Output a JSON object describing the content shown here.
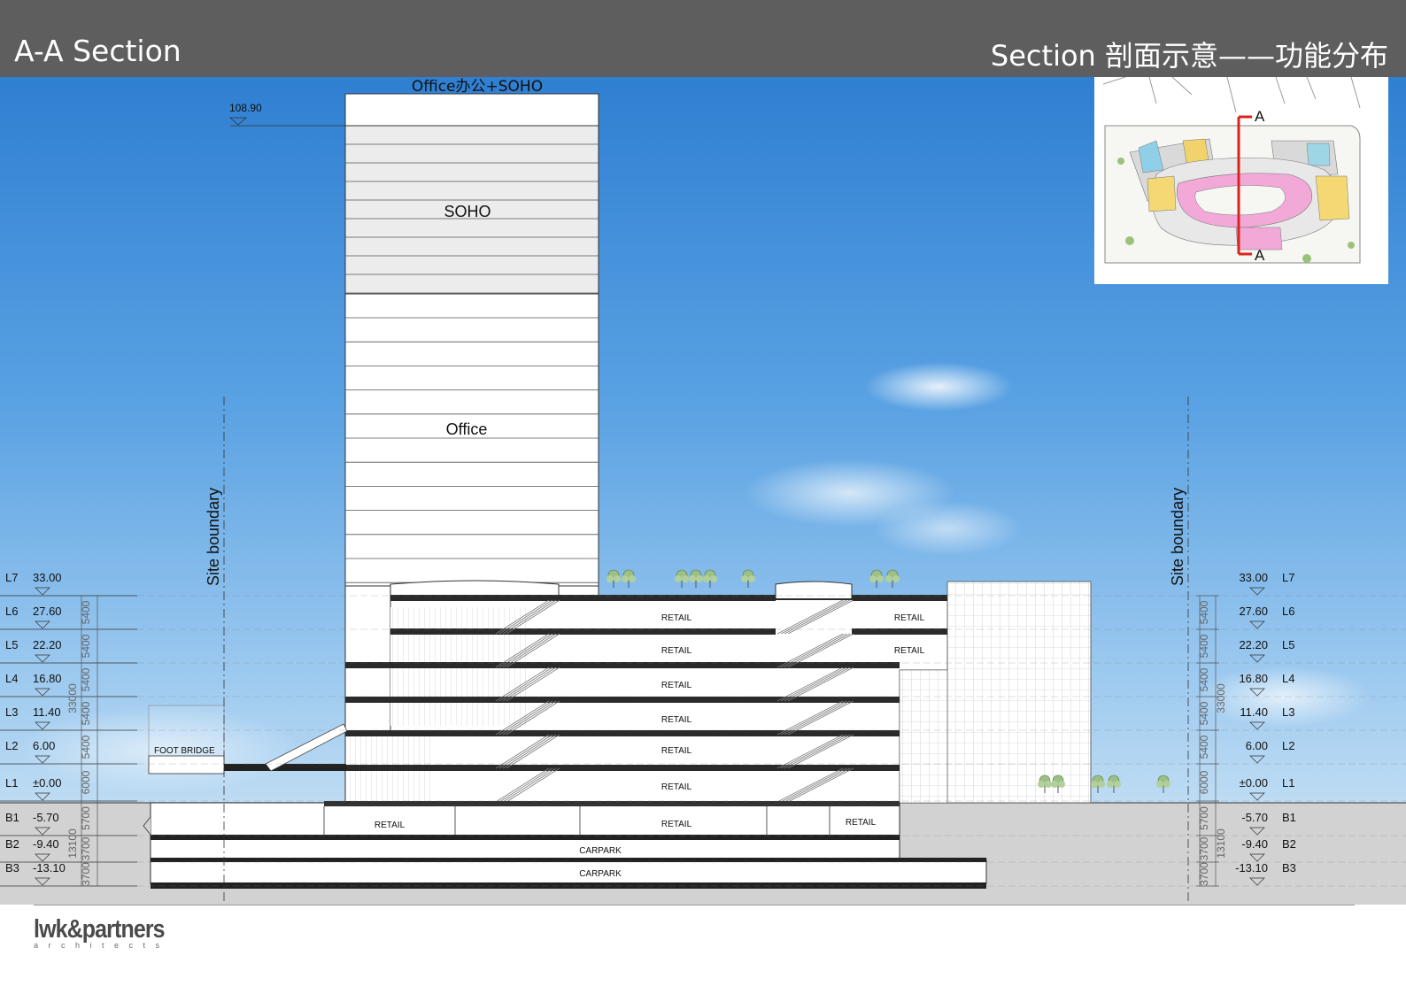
{
  "header": {
    "title": "A-A Section",
    "subtitle": "Section 剖面示意——功能分布",
    "background": "#5e5e5e"
  },
  "tower": {
    "top_label": "Office办公+SOHO",
    "top_level": "108.90",
    "soho_label": "SOHO",
    "office_label": "Office"
  },
  "site_boundary": {
    "left_label": "Site boundary",
    "right_label": "Site boundary"
  },
  "levels": [
    {
      "name": "L7",
      "elevation": "33.00"
    },
    {
      "name": "L6",
      "elevation": "27.60"
    },
    {
      "name": "L5",
      "elevation": "22.20"
    },
    {
      "name": "L4",
      "elevation": "16.80"
    },
    {
      "name": "L3",
      "elevation": "11.40"
    },
    {
      "name": "L2",
      "elevation": "6.00"
    },
    {
      "name": "L1",
      "elevation": "±0.00"
    },
    {
      "name": "B1",
      "elevation": "-5.70"
    },
    {
      "name": "B2",
      "elevation": "-9.40"
    },
    {
      "name": "B3",
      "elevation": "-13.10"
    }
  ],
  "dimensions": {
    "floor_heights": [
      "5400",
      "5400",
      "5400",
      "5400",
      "5400",
      "6000",
      "5700",
      "3700",
      "3700"
    ],
    "above_grade_total": "33000",
    "below_grade_total": "13100"
  },
  "labels": {
    "foot_bridge": "FOOT BRIDGE",
    "retail": "RETAIL",
    "carpark": "CARPARK"
  },
  "keyplan": {
    "marker_top": "A",
    "marker_bottom": "A",
    "section_line_color": "#d9251d"
  },
  "logo": {
    "brand": "lwk&partners",
    "sub": "architects"
  }
}
